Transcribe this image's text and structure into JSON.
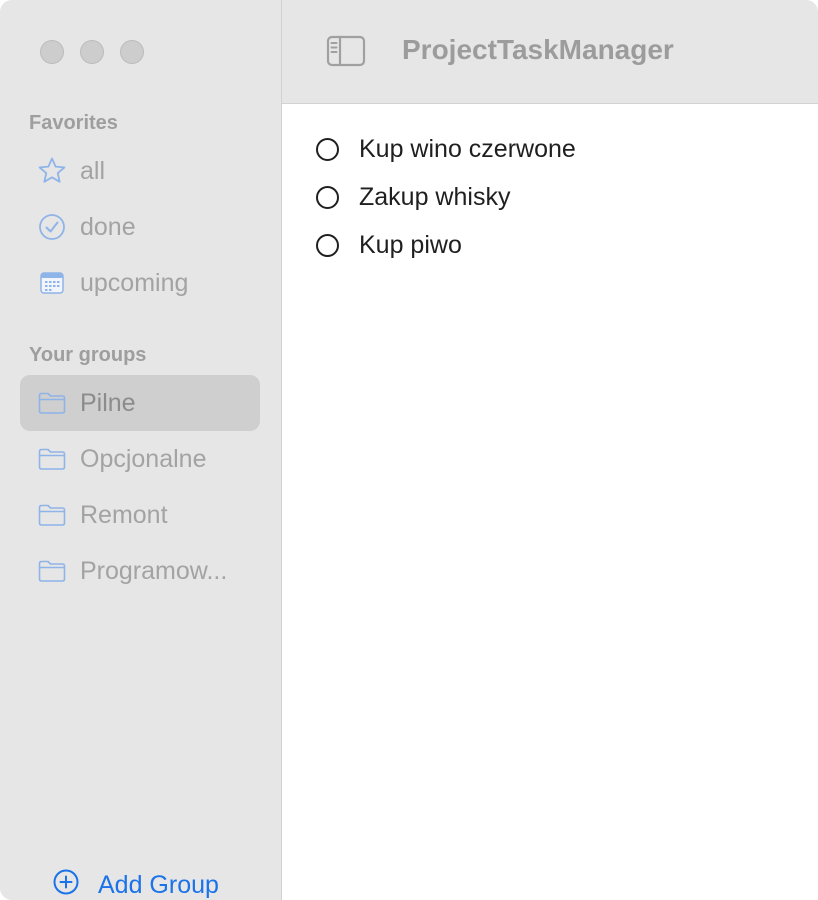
{
  "window": {
    "title": "ProjectTaskManager"
  },
  "sidebar": {
    "favorites_title": "Favorites",
    "favorites": [
      {
        "label": "all",
        "icon": "star-icon"
      },
      {
        "label": "done",
        "icon": "checkmark-circle-icon"
      },
      {
        "label": "upcoming",
        "icon": "calendar-icon"
      }
    ],
    "groups_title": "Your groups",
    "groups": [
      {
        "label": "Pilne",
        "icon": "folder-icon",
        "selected": true
      },
      {
        "label": "Opcjonalne",
        "icon": "folder-icon",
        "selected": false
      },
      {
        "label": "Remont",
        "icon": "folder-icon",
        "selected": false
      },
      {
        "label": "Programow...",
        "icon": "folder-icon",
        "selected": false
      }
    ],
    "add_group_label": "Add Group"
  },
  "tasks": [
    {
      "text": "Kup wino czerwone",
      "done": false
    },
    {
      "text": "Zakup whisky",
      "done": false
    },
    {
      "text": "Kup piwo",
      "done": false
    }
  ],
  "colors": {
    "accent": "#1a73e8",
    "sidebar_bg": "#e6e6e6",
    "selected_bg": "#cfcfcf",
    "icon_blue": "#8fb4e8"
  }
}
